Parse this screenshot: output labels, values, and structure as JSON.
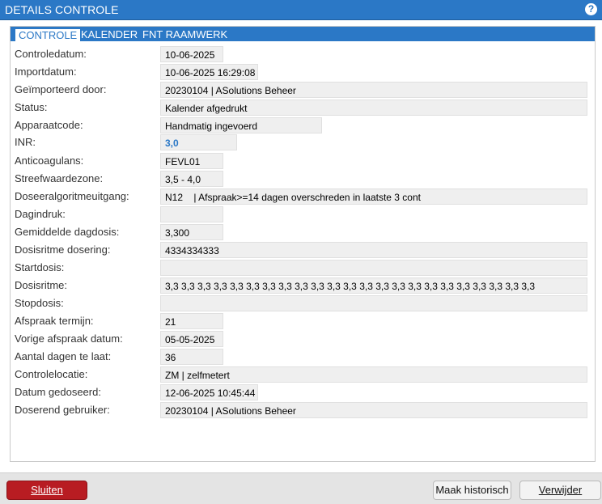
{
  "window": {
    "title": "DETAILS CONTROLE",
    "help_icon": "question-icon"
  },
  "tabs": [
    {
      "label": "CONTROLE",
      "active": true
    },
    {
      "label": "KALENDER",
      "active": false
    },
    {
      "label": "FNT RAAMWERK",
      "active": false
    }
  ],
  "fields": {
    "controledatum": {
      "label": "Controledatum:",
      "value": "10-06-2025"
    },
    "importdatum": {
      "label": "Importdatum:",
      "value": "10-06-2025 16:29:08"
    },
    "geimporteerd_door": {
      "label": "Geïmporteerd door:",
      "value": "20230104 | ASolutions Beheer"
    },
    "status": {
      "label": "Status:",
      "value": "Kalender afgedrukt"
    },
    "apparaatcode": {
      "label": "Apparaatcode:",
      "value": "Handmatig ingevoerd"
    },
    "inr": {
      "label": "INR:",
      "value": "3,0"
    },
    "anticoagulans": {
      "label": "Anticoagulans:",
      "value": "FEVL01"
    },
    "streefwaardezone": {
      "label": "Streefwaardezone:",
      "value": "3,5 - 4,0"
    },
    "doseeralgoritmeuitgang": {
      "label": "Doseeralgoritmeuitgang:",
      "value": "N12    | Afspraak>=14 dagen overschreden in laatste 3 cont"
    },
    "dagindruk": {
      "label": "Dagindruk:",
      "value": ""
    },
    "gemiddelde_dagdosis": {
      "label": "Gemiddelde dagdosis:",
      "value": "3,300"
    },
    "dosisritme_dosering": {
      "label": "Dosisritme dosering:",
      "value": "4334334333"
    },
    "startdosis": {
      "label": "Startdosis:",
      "value": ""
    },
    "dosisritme": {
      "label": "Dosisritme:",
      "value": "3,3 3,3 3,3 3,3 3,3 3,3 3,3 3,3 3,3 3,3 3,3 3,3 3,3 3,3 3,3 3,3 3,3 3,3 3,3 3,3 3,3 3,3 3,3"
    },
    "stopdosis": {
      "label": "Stopdosis:",
      "value": ""
    },
    "afspraak_termijn": {
      "label": "Afspraak termijn:",
      "value": "21"
    },
    "vorige_afspraak_datum": {
      "label": "Vorige afspraak datum:",
      "value": "05-05-2025"
    },
    "aantal_dagen_te_laat": {
      "label": "Aantal dagen te laat:",
      "value": "36"
    },
    "controlelocatie": {
      "label": "Controlelocatie:",
      "value": "ZM | zelfmetert"
    },
    "datum_gedoseerd": {
      "label": "Datum gedoseerd:",
      "value": "12-06-2025 10:45:44"
    },
    "doserend_gebruiker": {
      "label": "Doserend gebruiker:",
      "value": "20230104 | ASolutions Beheer"
    }
  },
  "footer": {
    "close_label": "Sluiten",
    "history_label": "Maak historisch",
    "delete_label": "Verwijder"
  },
  "colors": {
    "accent": "#2b78c6",
    "close_button": "#b81c22",
    "value_background": "#efefef"
  }
}
